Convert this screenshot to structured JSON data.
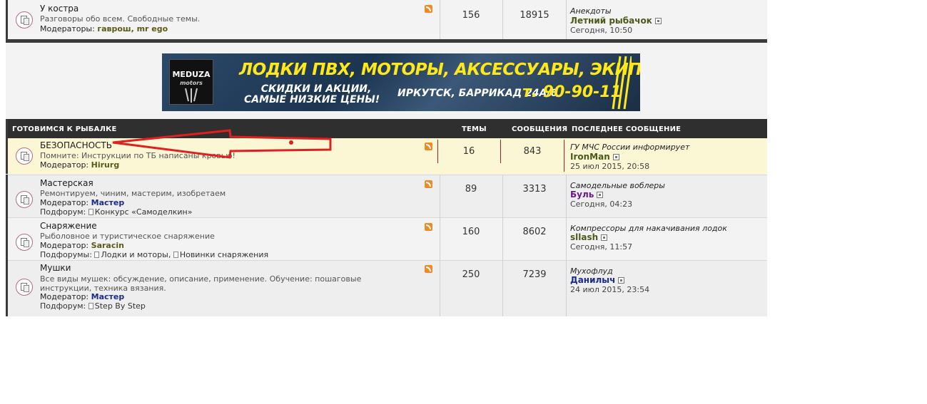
{
  "colors": {
    "header_bg": "#2f2f2f",
    "highlight_row": "#fbf6d4",
    "annotation_red": "#e02020"
  },
  "top_row": {
    "title": "У костра",
    "description": "Разговоры обо всем. Свободные темы.",
    "moderators_label": "Модераторы:",
    "moderators": "гаврош, mr ego",
    "topics": "156",
    "posts": "18915",
    "last_topic": "Анекдоты",
    "last_user": "Летний рыбачок",
    "last_date": "Сегодня, 10:50"
  },
  "banner": {
    "logo_text": "MEDUZA",
    "logo_sub": "motors",
    "line1": "ЛОДКИ ПВХ, МОТОРЫ, АКСЕССУАРЫ, ЭКИПИРОВКА",
    "line2a": "СКИДКИ И АКЦИИ,",
    "line2b": "САМЫЕ НИЗКИЕ ЦЕНЫ!",
    "address": "ИРКУТСК, БАРРИКАД 24А/6",
    "phone": "т. 90-90-11"
  },
  "category": {
    "title": "ГОТОВИМСЯ К РЫБАЛКЕ",
    "col_topics": "ТЕМЫ",
    "col_posts": "СООБЩЕНИЯ",
    "col_last": "ПОСЛЕДНЕЕ СООБЩЕНИЕ"
  },
  "forums": [
    {
      "title": "БЕЗОПАСНОСТЬ",
      "description": "Помните: Инструкции по ТБ написаны кровью!",
      "moderators_label": "Модератор:",
      "moderators": "Hirurg",
      "topics": "16",
      "posts": "843",
      "last_topic": "ГУ МЧС России информирует",
      "last_user": "IronMan",
      "last_date": "25 июл 2015, 20:58"
    },
    {
      "title": "Мастерская",
      "description": "Ремонтируем, чиним, мастерим, изобретаем",
      "moderators_label": "Модератор:",
      "moderators": "Мастер",
      "subforum_label": "Подфорум:",
      "subforums": [
        "Конкурс «Самоделкин»"
      ],
      "topics": "89",
      "posts": "3313",
      "last_topic": "Самодельные воблеры",
      "last_user": "Буль",
      "last_date": "Сегодня, 04:23"
    },
    {
      "title": "Снаряжение",
      "description": "Рыболовное и туристическое снаряжение",
      "moderators_label": "Модератор:",
      "moderators": "Saracin",
      "subforum_label": "Подфорумы:",
      "subforums": [
        "Лодки и моторы,",
        "Новинки снаряжения"
      ],
      "topics": "160",
      "posts": "8602",
      "last_topic": "Компрессоры для накачивания лодок",
      "last_user": "sllash",
      "last_date": "Сегодня, 11:57"
    },
    {
      "title": "Мушки",
      "description_line1": "Все виды мушек: обсуждение, описание, применение. Обучение: пошаговые",
      "description_line2": "инструкции, техника вязания.",
      "moderators_label": "Модератор:",
      "moderators": "Мастер",
      "subforum_label": "Подфорум:",
      "subforums": [
        "Step By Step"
      ],
      "topics": "250",
      "posts": "7239",
      "last_topic": "Мухофлуд",
      "last_user": "Данилыч",
      "last_date": "24 июл 2015, 23:54"
    }
  ]
}
